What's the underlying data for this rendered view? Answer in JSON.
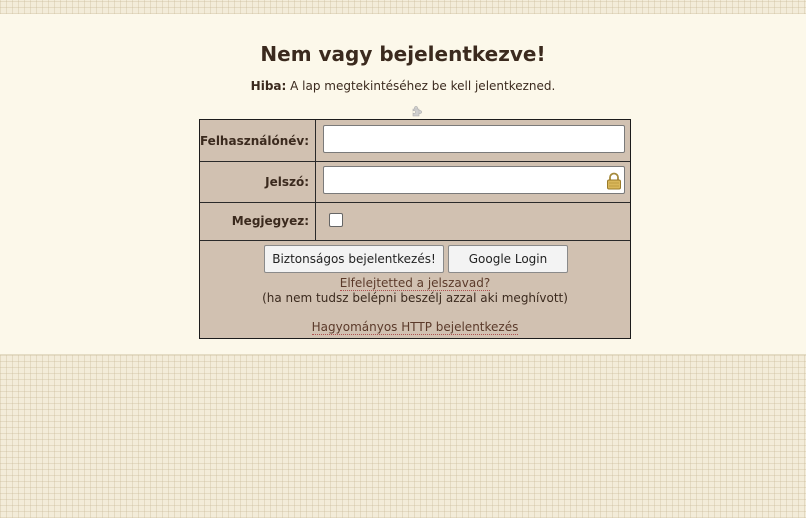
{
  "page": {
    "title": "Nem vagy bejelentkezve!",
    "error_label": "Hiba:",
    "error_text": "A lap megtekintéséhez be kell jelentkezned."
  },
  "form": {
    "username_label": "Felhasználónév:",
    "username_value": "",
    "password_label": "Jelszó:",
    "password_value": "",
    "remember_label": "Megjegyez:",
    "remember_checked": false,
    "secure_login_label": "Biztonságos bejelentkezés!",
    "google_login_label": "Google Login",
    "forgot_password_link": "Elfelejtetted a jelszavad?",
    "forgot_note": "(ha nem tudsz belépni beszélj azzal aki meghívott)",
    "http_login_link": "Hagyományos HTTP bejelentkezés"
  },
  "icons": {
    "small_icon": "puzzle-piece-icon",
    "password_icon": "lock-icon"
  },
  "colors": {
    "form_background": "#d1c1b1",
    "page_background": "#fcf8ea",
    "title_color": "#3b2a1e"
  }
}
